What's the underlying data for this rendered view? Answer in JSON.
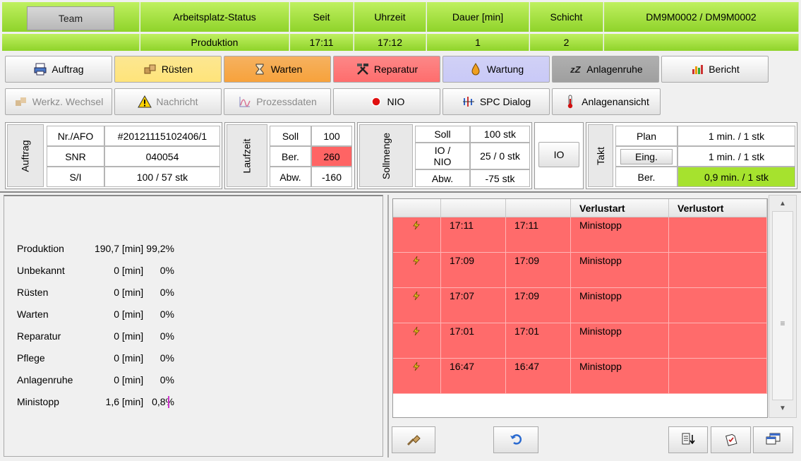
{
  "header": {
    "team": "Team",
    "columns": [
      {
        "label": "Arbeitsplatz-Status",
        "value": "Produktion"
      },
      {
        "label": "Seit",
        "value": "17:11"
      },
      {
        "label": "Uhrzeit",
        "value": "17:12"
      },
      {
        "label": "Dauer [min]",
        "value": "1"
      },
      {
        "label": "Schicht",
        "value": "2"
      },
      {
        "label": "DM9M0002  / DM9M0002",
        "value": ""
      }
    ]
  },
  "toolbar1": [
    {
      "label": "Auftrag",
      "icon": "printer-icon",
      "bg": "#ffffff"
    },
    {
      "label": "Rüsten",
      "icon": "boxes-icon",
      "bg": "#ffe47a"
    },
    {
      "label": "Warten",
      "icon": "hourglass-icon",
      "bg": "#f7a23c"
    },
    {
      "label": "Reparatur",
      "icon": "tools-icon",
      "bg": "#ff6d6d"
    },
    {
      "label": "Wartung",
      "icon": "oil-drop-icon",
      "bg": "#c9c9f7"
    },
    {
      "label": "Anlagenruhe",
      "icon": "sleep-icon",
      "bg": "#9f9f9f"
    },
    {
      "label": "Bericht",
      "icon": "report-icon",
      "bg": "#ffffff"
    }
  ],
  "toolbar2": [
    {
      "label": "Werkz. Wechsel",
      "icon": "tool-change-icon",
      "disabled": true
    },
    {
      "label": "Nachricht",
      "icon": "warning-icon",
      "disabled": true
    },
    {
      "label": "Prozessdaten",
      "icon": "chart-icon",
      "disabled": true
    },
    {
      "label": "NIO",
      "icon": "red-dot-icon",
      "disabled": false
    },
    {
      "label": "SPC Dialog",
      "icon": "spc-icon",
      "disabled": false
    },
    {
      "label": "Anlagenansicht",
      "icon": "thermometer-icon",
      "disabled": false
    }
  ],
  "auftrag": {
    "title": "Auftrag",
    "rows": [
      {
        "label": "Nr./AFO",
        "value": "#20121115102406/1"
      },
      {
        "label": "SNR",
        "value": "040054"
      },
      {
        "label": "S/I",
        "value": "100  / 57 stk"
      }
    ]
  },
  "laufzeit": {
    "title": "Laufzeit",
    "rows": [
      {
        "label": "Soll",
        "value": "100"
      },
      {
        "label": "Ber.",
        "value": "260"
      },
      {
        "label": "Abw.",
        "value": "-160"
      }
    ],
    "highlight_color": "#ff6464"
  },
  "sollmenge": {
    "title": "Sollmenge",
    "rows": [
      {
        "label": "Soll",
        "value": "100 stk"
      },
      {
        "label": "IO / NIO",
        "value": "25  / 0 stk"
      },
      {
        "label": "Abw.",
        "value": "-75 stk"
      }
    ],
    "io_button": "IO"
  },
  "takt": {
    "title": "Takt",
    "rows": [
      {
        "label": "Plan",
        "value": "1 min.  / 1 stk"
      },
      {
        "label": "Eing.",
        "value": "1 min.  / 1 stk"
      },
      {
        "label": "Ber.",
        "value": "0,9 min.  / 1   stk"
      }
    ],
    "highlight_color": "#a6e22e"
  },
  "stats": [
    {
      "name": "Produktion",
      "value": "190,7",
      "unit": "[min]",
      "pct": "99,2%"
    },
    {
      "name": "Unbekannt",
      "value": "0",
      "unit": "[min]",
      "pct": "0%"
    },
    {
      "name": "Rüsten",
      "value": "0",
      "unit": "[min]",
      "pct": "0%"
    },
    {
      "name": "Warten",
      "value": "0",
      "unit": "[min]",
      "pct": "0%"
    },
    {
      "name": "Reparatur",
      "value": "0",
      "unit": "[min]",
      "pct": "0%"
    },
    {
      "name": "Pflege",
      "value": "0",
      "unit": "[min]",
      "pct": "0%"
    },
    {
      "name": "Anlagenruhe",
      "value": "0",
      "unit": "[min]",
      "pct": "0%"
    },
    {
      "name": "Ministopp",
      "value": "1,6",
      "unit": "[min]",
      "pct": "0,8%"
    }
  ],
  "losses": {
    "headers": [
      "",
      "",
      "",
      "Verlustart",
      "Verlustort"
    ],
    "rows": [
      {
        "start": "17:11",
        "end": "17:11",
        "type": "Ministopp",
        "place": ""
      },
      {
        "start": "17:09",
        "end": "17:09",
        "type": "Ministopp",
        "place": ""
      },
      {
        "start": "17:07",
        "end": "17:09",
        "type": "Ministopp",
        "place": ""
      },
      {
        "start": "17:01",
        "end": "17:01",
        "type": "Ministopp",
        "place": ""
      },
      {
        "start": "16:47",
        "end": "16:47",
        "type": "Ministopp",
        "place": ""
      }
    ],
    "row_color": "#ff6b6b",
    "row_icon": "lightning-icon"
  },
  "bottom_buttons": [
    "brush-icon",
    "undo-icon",
    "sort-icon",
    "clipboard-icon",
    "window-icon"
  ]
}
